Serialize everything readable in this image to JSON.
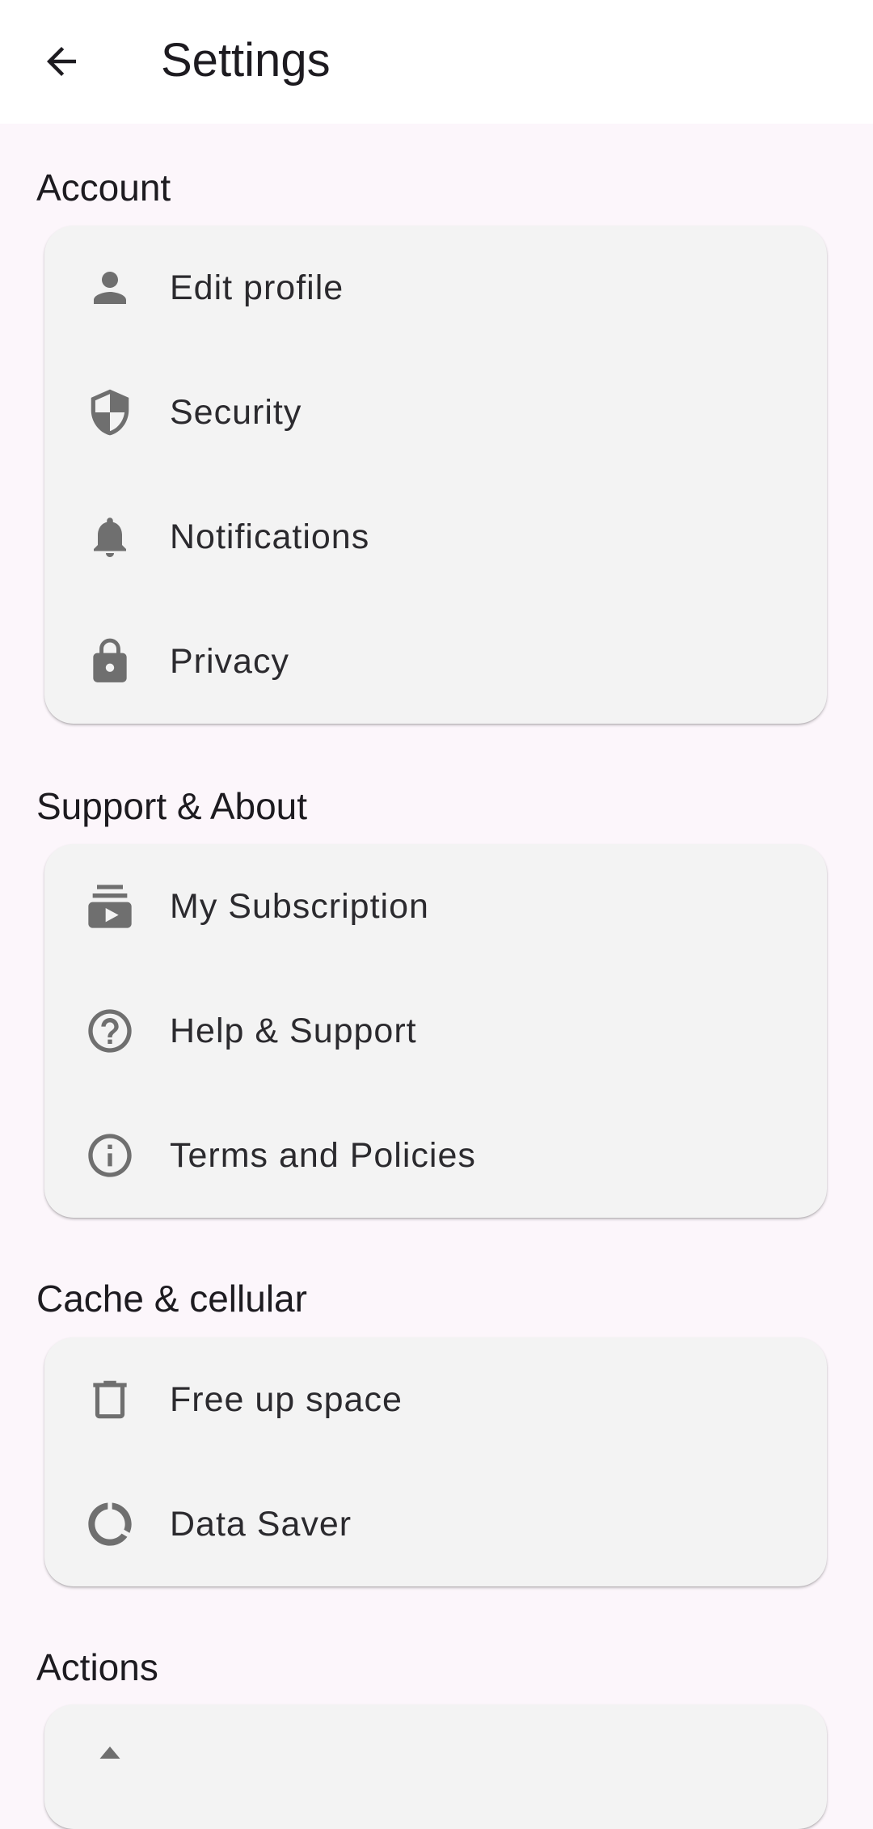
{
  "appbar": {
    "title": "Settings",
    "back_icon": "arrow-back-icon"
  },
  "sections": [
    {
      "title": "Account",
      "items": [
        {
          "label": "Edit profile",
          "icon": "person-icon"
        },
        {
          "label": "Security",
          "icon": "shield-icon"
        },
        {
          "label": "Notifications",
          "icon": "bell-icon"
        },
        {
          "label": "Privacy",
          "icon": "lock-icon"
        }
      ]
    },
    {
      "title": "Support & About",
      "items": [
        {
          "label": "My Subscription",
          "icon": "subscriptions-icon"
        },
        {
          "label": "Help & Support",
          "icon": "help-circle-icon"
        },
        {
          "label": "Terms and Policies",
          "icon": "info-circle-icon"
        }
      ]
    },
    {
      "title": "Cache & cellular",
      "items": [
        {
          "label": "Free up space",
          "icon": "trash-icon"
        },
        {
          "label": "Data Saver",
          "icon": "data-saver-icon"
        }
      ]
    },
    {
      "title": "Actions",
      "items": []
    }
  ],
  "colors": {
    "background": "#fcf6fb",
    "appbar": "#ffffff",
    "card": "#f3f3f3",
    "icon": "#6f6f6f",
    "text": "#1d1b20"
  }
}
